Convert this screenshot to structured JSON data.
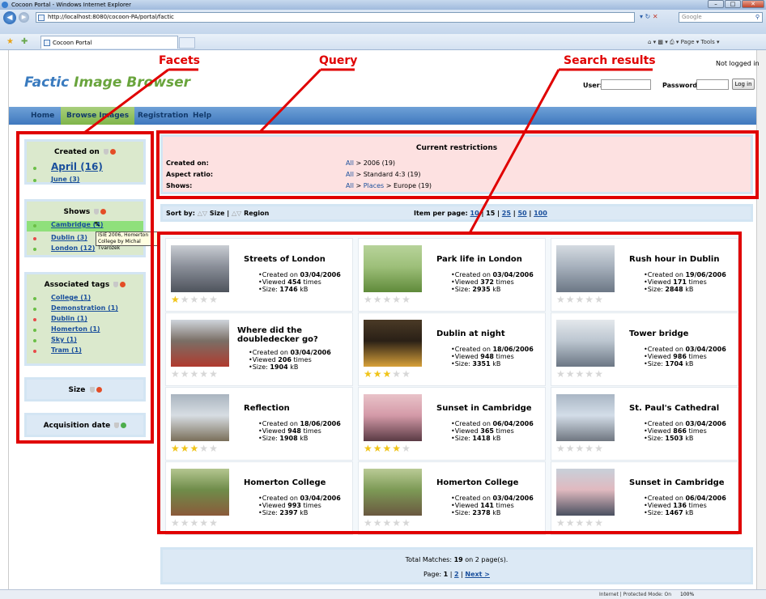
{
  "window": {
    "title": "Cocoon Portal - Windows Internet Explorer",
    "url": "http://localhost:8080/cocoon-PA/portal/factic",
    "search_placeholder": "Google",
    "tab_title": "Cocoon Portal",
    "toolbar": "Page ▾  Tools ▾",
    "status": "Internet | Protected Mode: On",
    "zoom": "100%"
  },
  "header": {
    "title_part1": "Factic ",
    "title_part2": "Image Browser",
    "not_logged_in": "Not logged in",
    "user_label": "User:",
    "password_label": "Password:",
    "login_button": "Log in"
  },
  "menu": [
    "Home",
    "Browse Images",
    "Registration",
    "Help"
  ],
  "facets": {
    "created_on": {
      "title": "Created on",
      "items": [
        {
          "label": "April (16)"
        },
        {
          "label": "June (3)"
        }
      ]
    },
    "shows": {
      "title": "Shows",
      "items": [
        {
          "label": "Cambridge (4)"
        },
        {
          "label": "Dublin (3)"
        },
        {
          "label": "London (12)"
        }
      ],
      "tooltip": "ISIE 2006, Homerton College by Michal Tvarozek"
    },
    "associated_tags": {
      "title": "Associated tags",
      "items": [
        {
          "label": "College (1)"
        },
        {
          "label": "Demonstration (1)"
        },
        {
          "label": "Dublin (1)"
        },
        {
          "label": "Homerton (1)"
        },
        {
          "label": "Sky (1)"
        },
        {
          "label": "Tram (1)"
        }
      ]
    },
    "size": {
      "title": "Size"
    },
    "acquisition_date": {
      "title": "Acquisition date"
    }
  },
  "restrictions": {
    "title": "Current restrictions",
    "rows": [
      {
        "label": "Created on:",
        "all": "All",
        "rest": " > 2006 (19)"
      },
      {
        "label": "Aspect ratio:",
        "all": "All",
        "rest": " > Standard 4:3 (19)"
      },
      {
        "label": "Shows:",
        "all": "All",
        "mid": "Places",
        "rest": " > Europe (19)"
      }
    ]
  },
  "sort": {
    "label": "Sort by:",
    "size": "Size",
    "sep": "|",
    "region": "Region",
    "per_page_label": "Item per page:",
    "per_page_options": [
      "10",
      "15",
      "25",
      "50",
      "100"
    ]
  },
  "results": [
    {
      "title": "Streets of London",
      "created": "03/04/2006",
      "viewed": "454",
      "size": "1746",
      "stars": 1
    },
    {
      "title": "Park life in London",
      "created": "03/04/2006",
      "viewed": "372",
      "size": "2935",
      "stars": 0
    },
    {
      "title": "Rush hour in Dublin",
      "created": "19/06/2006",
      "viewed": "171",
      "size": "2848",
      "stars": 0
    },
    {
      "title": "Where did the doubledecker go?",
      "created": "03/04/2006",
      "viewed": "206",
      "size": "1904",
      "stars": 0
    },
    {
      "title": "Dublin at night",
      "created": "18/06/2006",
      "viewed": "948",
      "size": "3351",
      "stars": 3
    },
    {
      "title": "Tower bridge",
      "created": "03/04/2006",
      "viewed": "986",
      "size": "1704",
      "stars": 0
    },
    {
      "title": "Reflection",
      "created": "18/06/2006",
      "viewed": "948",
      "size": "1908",
      "stars": 3
    },
    {
      "title": "Sunset in Cambridge",
      "created": "06/04/2006",
      "viewed": "365",
      "size": "1418",
      "stars": 4
    },
    {
      "title": "St. Paul's Cathedral",
      "created": "03/04/2006",
      "viewed": "866",
      "size": "1503",
      "stars": 0
    },
    {
      "title": "Homerton College",
      "created": "03/04/2006",
      "viewed": "993",
      "size": "2397",
      "stars": 0
    },
    {
      "title": "Homerton College",
      "created": "03/04/2006",
      "viewed": "141",
      "size": "2378",
      "stars": 0
    },
    {
      "title": "Sunset in Cambridge",
      "created": "06/04/2006",
      "viewed": "136",
      "size": "1467",
      "stars": 0
    }
  ],
  "result_text": {
    "created_prefix": "Created on ",
    "viewed_prefix": "Viewed ",
    "viewed_suffix": " times",
    "size_prefix": "Size: ",
    "size_suffix": " kB"
  },
  "pager": {
    "total_prefix": "Total Matches: ",
    "total": "19",
    "total_suffix": " on 2 page(s).",
    "page_label": "Page: ",
    "current": "1",
    "sep": "|",
    "page2": "2",
    "next": "Next >"
  },
  "annotations": {
    "facets": "Facets",
    "query": "Query",
    "results": "Search results"
  },
  "colors": {
    "annotation": "#e00000",
    "menu_active": "#7fb54a",
    "link": "#1a4f9c",
    "star": "#f0c419"
  }
}
